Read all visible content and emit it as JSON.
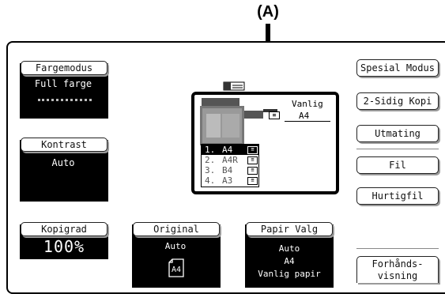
{
  "callout": "(A)",
  "left_controls": {
    "color_mode": {
      "label": "Fargemodus",
      "value": "Full farge"
    },
    "contrast": {
      "label": "Kontrast",
      "value": "Auto"
    },
    "copy_ratio": {
      "label": "Kopigrad",
      "value": "100%"
    }
  },
  "bottom_controls": {
    "original": {
      "label": "Original",
      "value": "Auto",
      "paper": "A4"
    },
    "paper_select": {
      "label": "Papir Valg",
      "line1": "Auto",
      "line2": "A4",
      "line3": "Vanlig papir"
    }
  },
  "preview": {
    "tray_paper_type": "Vanlig",
    "tray_paper_size": "A4",
    "trays": [
      {
        "num": "1.",
        "size": "A4"
      },
      {
        "num": "2.",
        "size": "A4R"
      },
      {
        "num": "3.",
        "size": "B4"
      },
      {
        "num": "4.",
        "size": "A3"
      }
    ]
  },
  "right_buttons": {
    "special_modes": "Spesial Modus",
    "duplex": "2-Sidig Kopi",
    "output": "Utmating",
    "file": "Fil",
    "quick_file": "Hurtigfil",
    "preview_line1": "Forhånds-",
    "preview_line2": "visning"
  }
}
